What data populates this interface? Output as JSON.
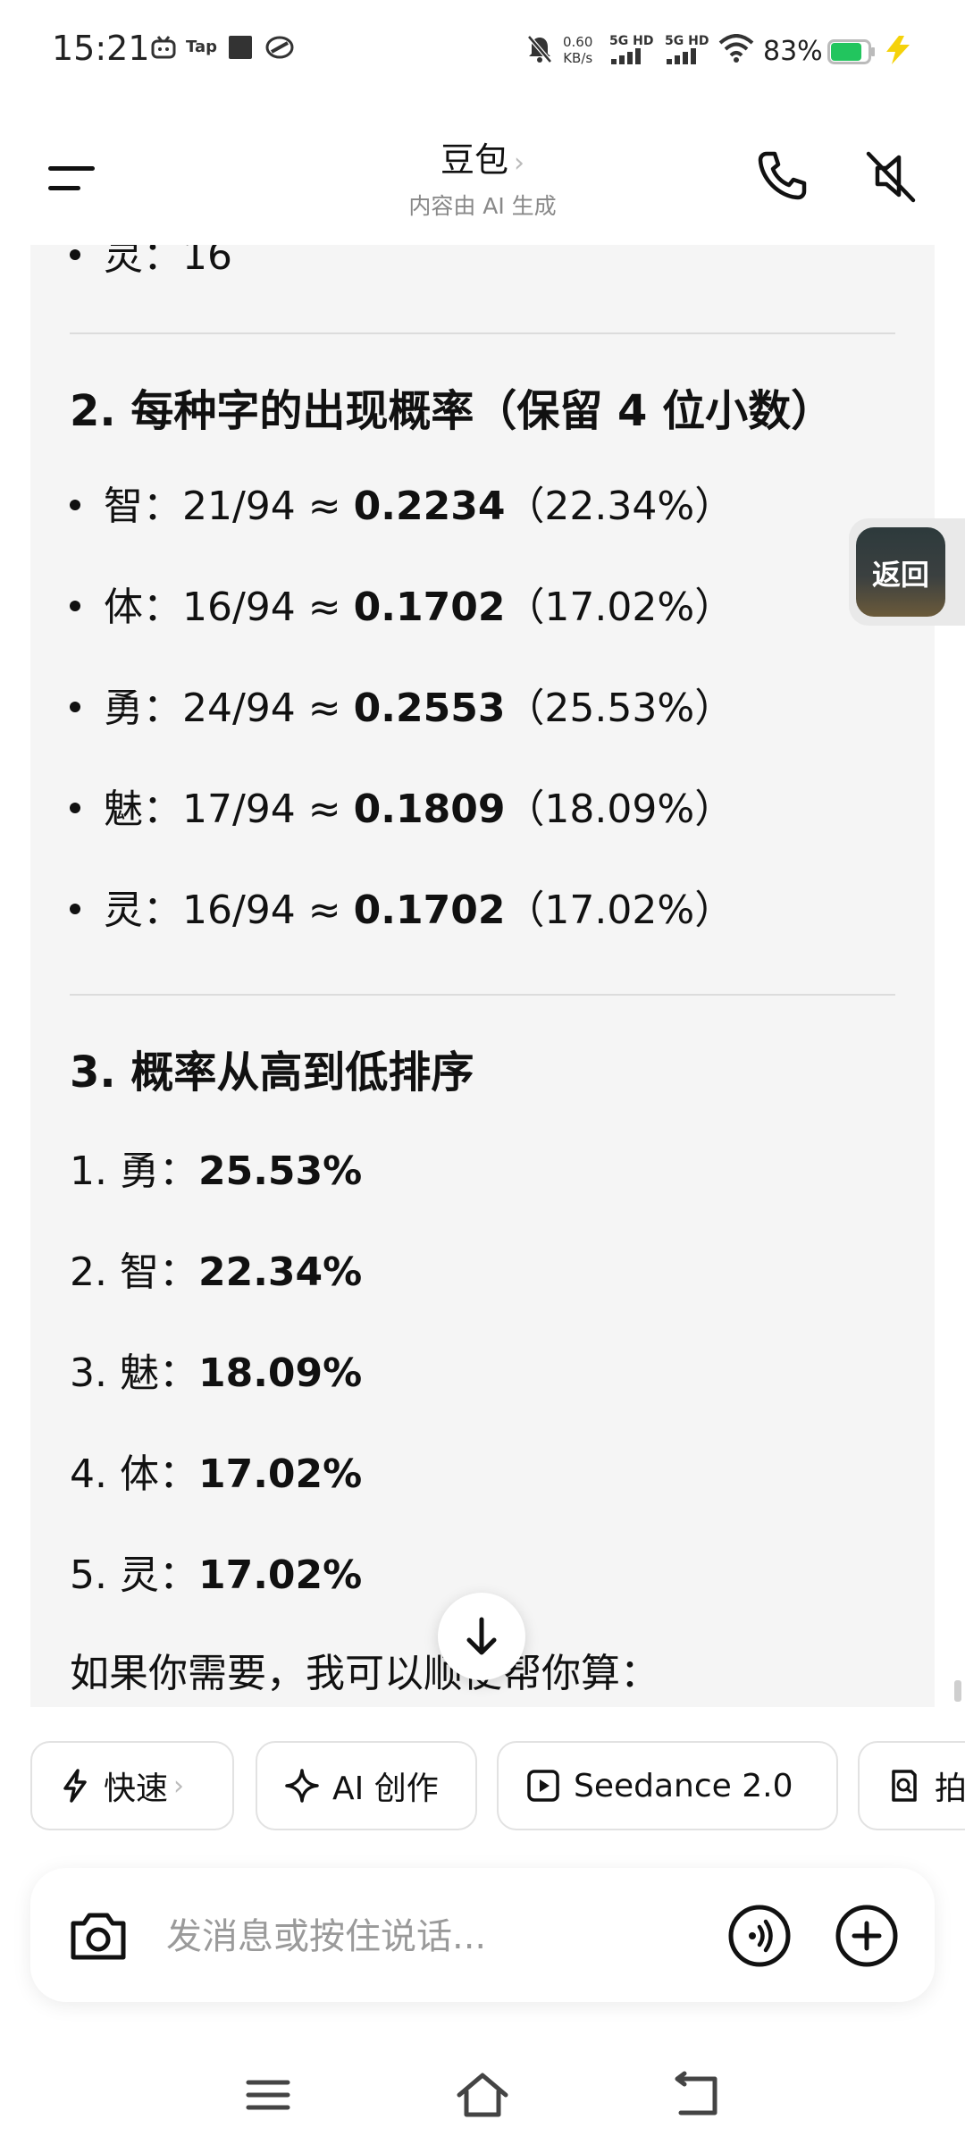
{
  "status_bar": {
    "time": "15:21",
    "speed_value": "0.60",
    "speed_unit": "KB/s",
    "signal_1_label": "5G HD",
    "signal_2_label": "5G HD",
    "battery_text": "83%",
    "battery_level": 0.83,
    "battery_color": "#22c55e",
    "charge_color": "#f5d20a"
  },
  "header": {
    "title": "豆包",
    "title_chevron": "›",
    "subtitle": "内容由 AI 生成"
  },
  "content": {
    "top_partial": {
      "char": "灵",
      "value": "：16"
    },
    "section2": {
      "heading": "2. 每种字的出现概率（保留 4 位小数）",
      "items": [
        {
          "char": "智",
          "fraction": "：21/94 ≈ ",
          "prob": "0.2234",
          "pct": "（22.34%）"
        },
        {
          "char": "体",
          "fraction": "：16/94 ≈ ",
          "prob": "0.1702",
          "pct": "（17.02%）"
        },
        {
          "char": "勇",
          "fraction": "：24/94 ≈ ",
          "prob": "0.2553",
          "pct": "（25.53%）"
        },
        {
          "char": "魅",
          "fraction": "：17/94 ≈ ",
          "prob": "0.1809",
          "pct": "（18.09%）"
        },
        {
          "char": "灵",
          "fraction": "：16/94 ≈ ",
          "prob": "0.1702",
          "pct": "（17.02%）"
        }
      ]
    },
    "section3": {
      "heading": "3. 概率从高到低排序",
      "items": [
        {
          "label": "1. 勇：",
          "value": "25.53%"
        },
        {
          "label": "2. 智：",
          "value": "22.34%"
        },
        {
          "label": "3. 魅：",
          "value": "18.09%"
        },
        {
          "label": "4. 体：",
          "value": "17.02%"
        },
        {
          "label": "5. 灵：",
          "value": "17.02%"
        }
      ]
    },
    "closing_text": "如果你需要，我可以顺便帮你算："
  },
  "back_widget": {
    "label": "返回"
  },
  "tools": [
    {
      "label": "快速",
      "chevron": "›",
      "icon": "lightning-icon"
    },
    {
      "label": "AI 创作",
      "icon": "sparkle-icon"
    },
    {
      "label": "Seedance 2.0",
      "icon": "play-square-icon"
    },
    {
      "label": "拍",
      "icon": "search-doc-icon"
    }
  ],
  "input": {
    "placeholder": "发消息或按住说话...",
    "value": ""
  }
}
